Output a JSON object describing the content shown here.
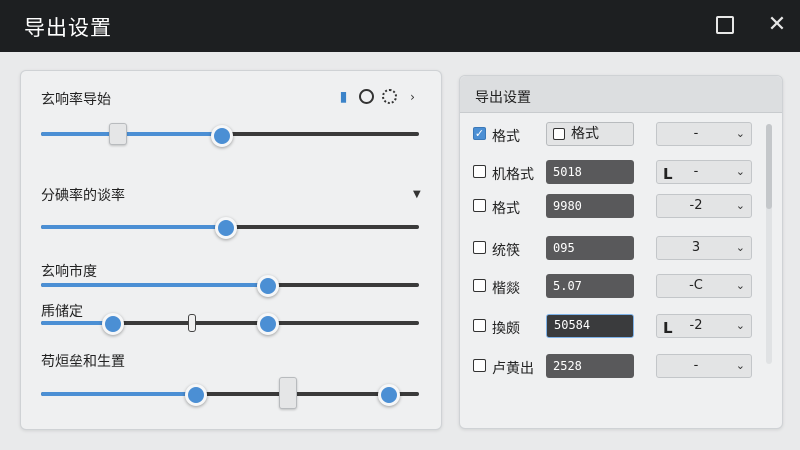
{
  "window": {
    "title": "导出设置",
    "maximize_icon": "maximize-icon",
    "close_icon": "close-icon",
    "close_glyph": "✕"
  },
  "left_panel": {
    "s1_label": "玄响率导始",
    "s2_label": "分碘率的谈率",
    "s3_label": "玄响市度",
    "s4_label": "乕储定",
    "s5_label": "苟烜垒和生置",
    "icons": [
      "bookmark-icon",
      "circle-icon",
      "dotted-circle-icon",
      "chevron-right-icon"
    ],
    "sliders": {
      "s1": {
        "value": 0.48,
        "handle": 0.2
      },
      "s2": {
        "value": 0.49
      },
      "s3": {
        "value": 0.6
      },
      "s4": {
        "low": 0.19,
        "mid": 0.4,
        "high": 0.6
      },
      "s5": {
        "low": 0.41,
        "mid": 0.65,
        "high": 0.92
      }
    }
  },
  "right_panel": {
    "header": "导出设置",
    "rows": [
      {
        "label": "格式",
        "checked": true,
        "field": "格式",
        "field_style": "checkbox",
        "select": "-",
        "L": ""
      },
      {
        "label": "机格式",
        "checked": false,
        "field": "5018",
        "select": "-",
        "L": "L"
      },
      {
        "label": "格式",
        "checked": false,
        "field": "9980",
        "select": "-2",
        "L": ""
      },
      {
        "label": "统筷",
        "checked": false,
        "field": "095",
        "select": "3",
        "L": ""
      },
      {
        "label": "楷燚",
        "checked": false,
        "field": "5.07",
        "select": "-C",
        "L": ""
      },
      {
        "label": "換颇",
        "checked": false,
        "field": "50584",
        "select": "-2",
        "L": "L",
        "focused": true
      },
      {
        "label": "卢黄出",
        "checked": false,
        "field": "2528",
        "select": "-",
        "L": ""
      }
    ]
  },
  "colors": {
    "accent": "#4b8fd4",
    "titlebar": "#1d1f21",
    "panel": "#eff0f1"
  }
}
